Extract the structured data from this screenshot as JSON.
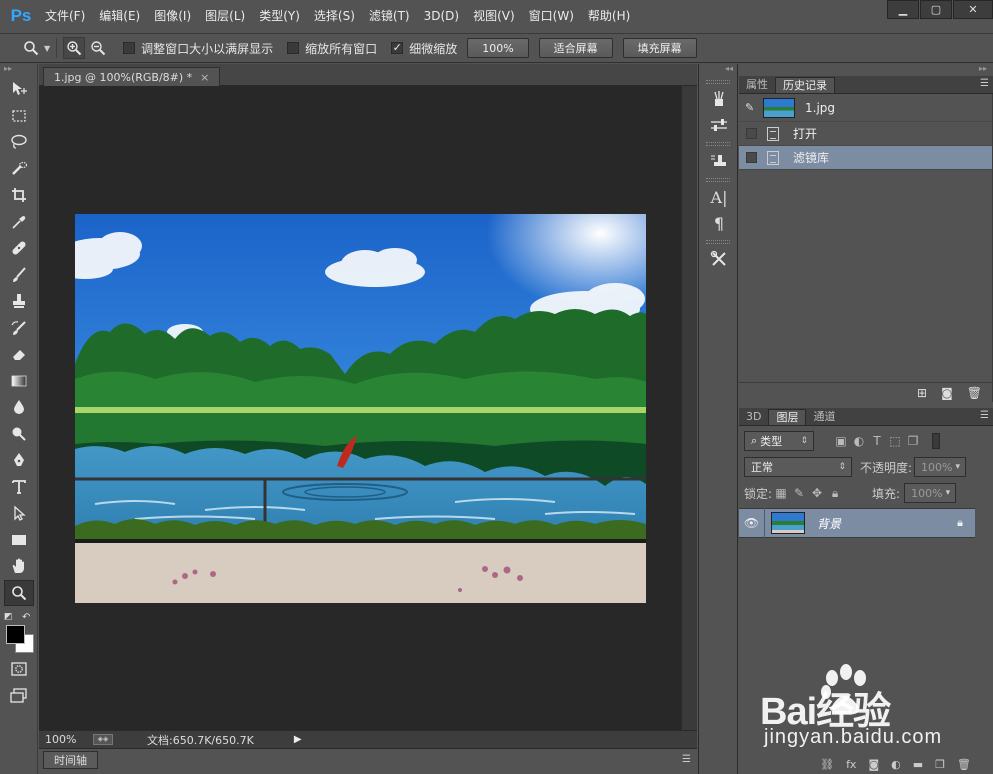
{
  "app": {
    "logo": "Ps"
  },
  "menu": [
    "文件(F)",
    "编辑(E)",
    "图像(I)",
    "图层(L)",
    "类型(Y)",
    "选择(S)",
    "滤镜(T)",
    "3D(D)",
    "视图(V)",
    "窗口(W)",
    "帮助(H)"
  ],
  "options": {
    "resize_windows": "调整窗口大小以满屏显示",
    "zoom_all_windows": "缩放所有窗口",
    "scrubby_zoom": "细微缩放",
    "scrubby_zoom_checked": true,
    "btn_100": "100%",
    "btn_fit": "适合屏幕",
    "btn_fill": "填充屏幕"
  },
  "document": {
    "tab_title": "1.jpg @ 100%(RGB/8#) *",
    "close": "×",
    "zoom": "100%",
    "doc_info": "文档:650.7K/650.7K",
    "timeline_tab": "时间轴"
  },
  "history_panel": {
    "tabs": [
      "属性",
      "历史记录"
    ],
    "active_tab": 1,
    "snapshot_name": "1.jpg",
    "steps": [
      "打开",
      "滤镜库"
    ]
  },
  "layers_panel": {
    "tabs": [
      "3D",
      "图层",
      "通道"
    ],
    "active_tab": 1,
    "filter_kind": "类型",
    "blend_mode": "正常",
    "opacity_label": "不透明度:",
    "opacity_value": "100%",
    "lock_label": "锁定:",
    "fill_label": "填充:",
    "fill_value": "100%",
    "layers": [
      {
        "name": "背景",
        "visible": true,
        "locked": true
      }
    ]
  },
  "watermark": {
    "brand": "Bai经验",
    "url": "jingyan.baidu.com"
  }
}
